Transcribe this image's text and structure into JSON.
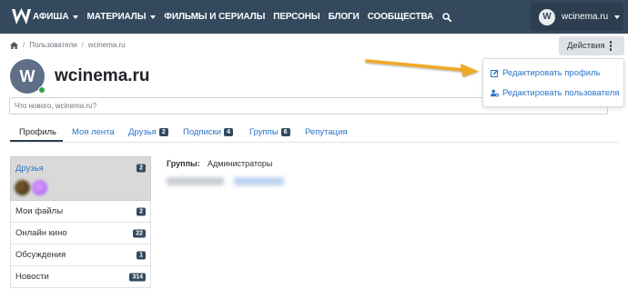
{
  "navbar": {
    "logo_letter": "W",
    "items": [
      {
        "label": "АФИША",
        "has_caret": true
      },
      {
        "label": "МАТЕРИАЛЫ",
        "has_caret": true
      },
      {
        "label": "ФИЛЬМЫ И СЕРИАЛЫ",
        "has_caret": false
      },
      {
        "label": "ПЕРСОНЫ",
        "has_caret": false
      },
      {
        "label": "БЛОГИ",
        "has_caret": false
      },
      {
        "label": "СООБЩЕСТВА",
        "has_caret": false
      }
    ],
    "search_icon": "search-icon",
    "user": {
      "avatar_letter": "W",
      "name": "wcinema.ru"
    }
  },
  "breadcrumb": {
    "home_icon": "home-icon",
    "items": [
      "Пользователи",
      "wcinema.ru"
    ]
  },
  "actions": {
    "label": "Действия",
    "menu": [
      {
        "label": "Редактировать профиль",
        "icon": "edit-icon"
      },
      {
        "label": "Редактировать пользователя",
        "icon": "user-cog-icon"
      }
    ]
  },
  "profile": {
    "avatar_letter": "W",
    "name": "wcinema.ru",
    "online": true,
    "status_placeholder": "Что нового, wcinema.ru?"
  },
  "tabs": [
    {
      "label": "Профиль",
      "active": true,
      "count": null
    },
    {
      "label": "Моя лента",
      "active": false,
      "count": null
    },
    {
      "label": "Друзья",
      "active": false,
      "count": "2"
    },
    {
      "label": "Подписки",
      "active": false,
      "count": "4"
    },
    {
      "label": "Группы",
      "active": false,
      "count": "6"
    },
    {
      "label": "Репутация",
      "active": false,
      "count": null
    }
  ],
  "sidebar": {
    "friends": {
      "label": "Друзья",
      "count": "2"
    },
    "items": [
      {
        "label": "Мои файлы",
        "count": "2"
      },
      {
        "label": "Онлайн кино",
        "count": "22"
      },
      {
        "label": "Обсуждения",
        "count": "1"
      },
      {
        "label": "Новости",
        "count": "314"
      }
    ]
  },
  "main": {
    "groups_label": "Группы:",
    "groups_value": "Администраторы"
  },
  "colors": {
    "navbar": "#34495e",
    "link": "#2c73c9",
    "badge": "#34495e",
    "online": "#28a745",
    "annotation_arrow": "#f0a824"
  }
}
